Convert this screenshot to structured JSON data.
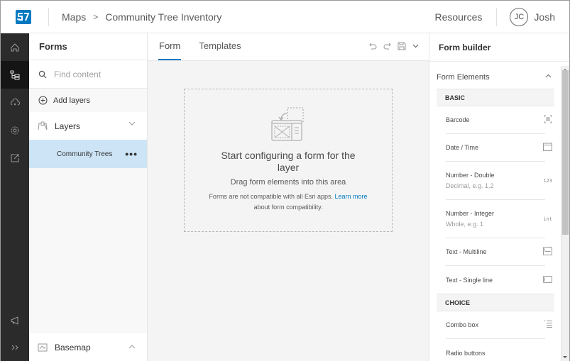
{
  "header": {
    "logo_icon": "esri-field-maps-designer-logo",
    "breadcrumb": [
      "Maps",
      "Community Tree Inventory"
    ],
    "breadcrumb_separator": ">",
    "resources_label": "Resources",
    "user_initials": "JC",
    "user_name": "Josh"
  },
  "action_bar": {
    "items": [
      {
        "icon": "home-icon",
        "active": false
      },
      {
        "icon": "forms-tree-icon",
        "active": true
      },
      {
        "icon": "offline-cloud-icon",
        "active": false
      },
      {
        "icon": "settings-icon",
        "active": false
      },
      {
        "icon": "share-icon",
        "active": false
      }
    ],
    "bottom_items": [
      {
        "icon": "feedback-megaphone-icon"
      },
      {
        "icon": "expand-chevrons-icon"
      }
    ]
  },
  "left_panel": {
    "title": "Forms",
    "search_placeholder": "Find content",
    "add_layers_label": "Add layers",
    "layers_label": "Layers",
    "selected_layer": "Community Trees",
    "more_label": "•••",
    "basemap_label": "Basemap"
  },
  "center": {
    "tabs": [
      {
        "label": "Form",
        "active": true
      },
      {
        "label": "Templates",
        "active": false
      }
    ],
    "dropzone": {
      "title": "Start configuring a form for the layer",
      "subtitle": "Drag form elements into this area",
      "note_prefix": "Forms are not compatible with all Esri apps.",
      "note_link": "Learn more",
      "note_suffix": "about form compatibility."
    }
  },
  "right_panel": {
    "title": "Form builder",
    "section_label": "Form Elements",
    "groups": [
      {
        "label": "BASIC",
        "items": [
          {
            "label": "Barcode",
            "sub": "",
            "icon": "barcode-icon"
          },
          {
            "label": "Date / Time",
            "sub": "",
            "icon": "calendar-icon"
          },
          {
            "label": "Number - Double",
            "sub": "Decimal, e.g. 1.2",
            "icon_text": "123"
          },
          {
            "label": "Number - Integer",
            "sub": "Whole, e.g. 1",
            "icon_text": "int"
          },
          {
            "label": "Text - Multiline",
            "sub": "",
            "icon": "text-multiline-icon"
          },
          {
            "label": "Text - Single line",
            "sub": "",
            "icon": "text-single-line-icon"
          }
        ]
      },
      {
        "label": "CHOICE",
        "items": [
          {
            "label": "Combo box",
            "sub": "",
            "icon": "combo-box-icon"
          },
          {
            "label": "Radio buttons",
            "sub": "",
            "icon": ""
          }
        ]
      }
    ]
  },
  "colors": {
    "accent": "#0079c1",
    "selected_row": "#cce4f5",
    "action_bar": "#2b2b2b",
    "action_bar_active": "#151515"
  }
}
